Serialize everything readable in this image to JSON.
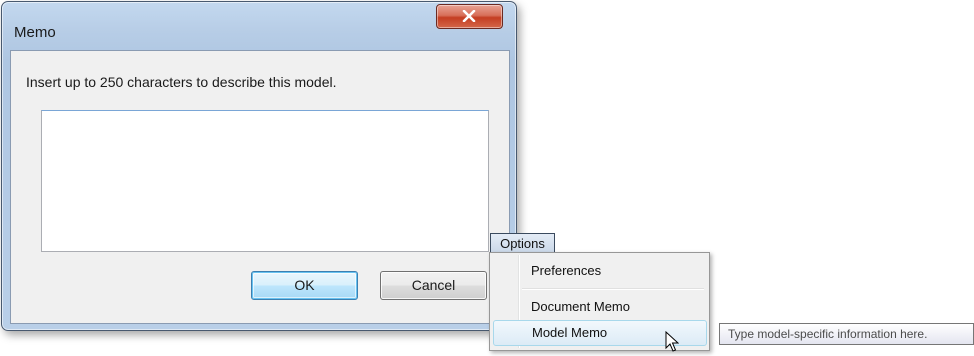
{
  "dialog": {
    "title": "Memo",
    "instruction": "Insert up to 250 characters to describe this model.",
    "memo_value": "",
    "ok_label": "OK",
    "cancel_label": "Cancel"
  },
  "options_menu": {
    "title": "Options",
    "items": [
      {
        "label": "Preferences"
      },
      {
        "label": "Document Memo"
      },
      {
        "label": "Model Memo",
        "highlighted": true
      }
    ]
  },
  "tooltip": {
    "text": "Type model-specific information here."
  },
  "icons": {
    "close": "close-icon",
    "cursor": "arrow-cursor-icon"
  },
  "colors": {
    "close_button": "#c43e22",
    "ok_button_border": "#3c7fb1",
    "menu_highlight": "#dcebf6"
  }
}
